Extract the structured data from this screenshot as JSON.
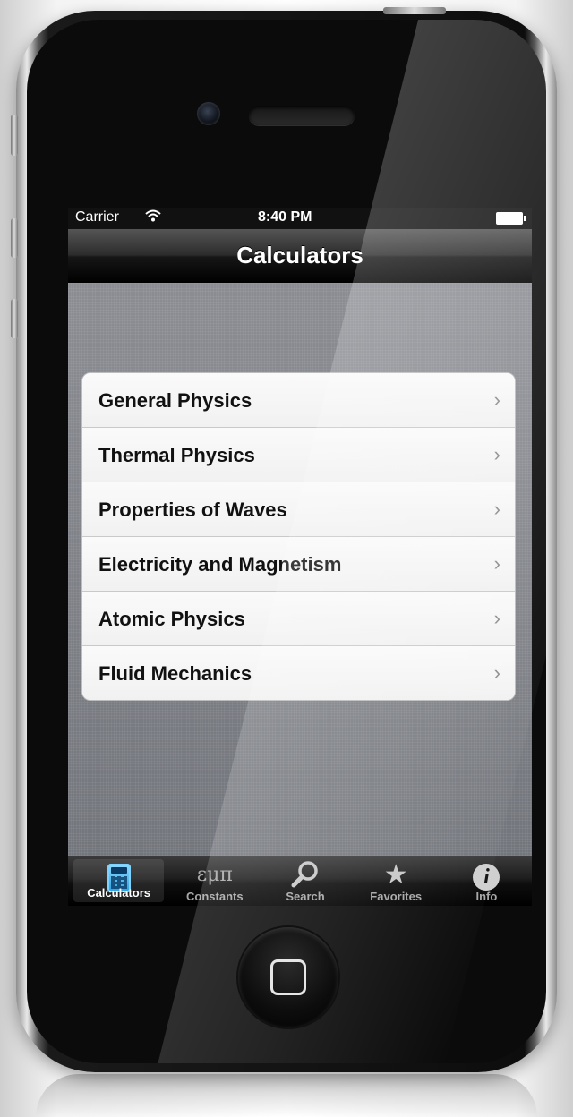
{
  "status_bar": {
    "carrier": "Carrier",
    "wifi_icon": "wifi-icon",
    "time": "8:40 PM",
    "battery_icon": "battery-icon"
  },
  "nav": {
    "title": "Calculators"
  },
  "list": {
    "items": [
      {
        "label": "General Physics",
        "chevron": "›"
      },
      {
        "label": "Thermal Physics",
        "chevron": "›"
      },
      {
        "label": "Properties of Waves",
        "chevron": "›"
      },
      {
        "label": "Electricity and Magnetism",
        "chevron": "›"
      },
      {
        "label": "Atomic Physics",
        "chevron": "›"
      },
      {
        "label": "Fluid Mechanics",
        "chevron": "›"
      }
    ]
  },
  "tab_bar": {
    "tabs": [
      {
        "label": "Calculators",
        "icon": "calculator-icon",
        "active": true
      },
      {
        "label": "Constants",
        "icon": "constants-icon",
        "glyph": "εμπ",
        "active": false
      },
      {
        "label": "Search",
        "icon": "search-icon",
        "glyph": "⚲",
        "active": false
      },
      {
        "label": "Favorites",
        "icon": "star-icon",
        "glyph": "★",
        "active": false
      },
      {
        "label": "Info",
        "icon": "info-icon",
        "glyph": "i",
        "active": false
      }
    ]
  },
  "colors": {
    "nav_bar": "#1e1e1e",
    "tab_active": "#2a9fe0",
    "background": "#7a7c82"
  }
}
